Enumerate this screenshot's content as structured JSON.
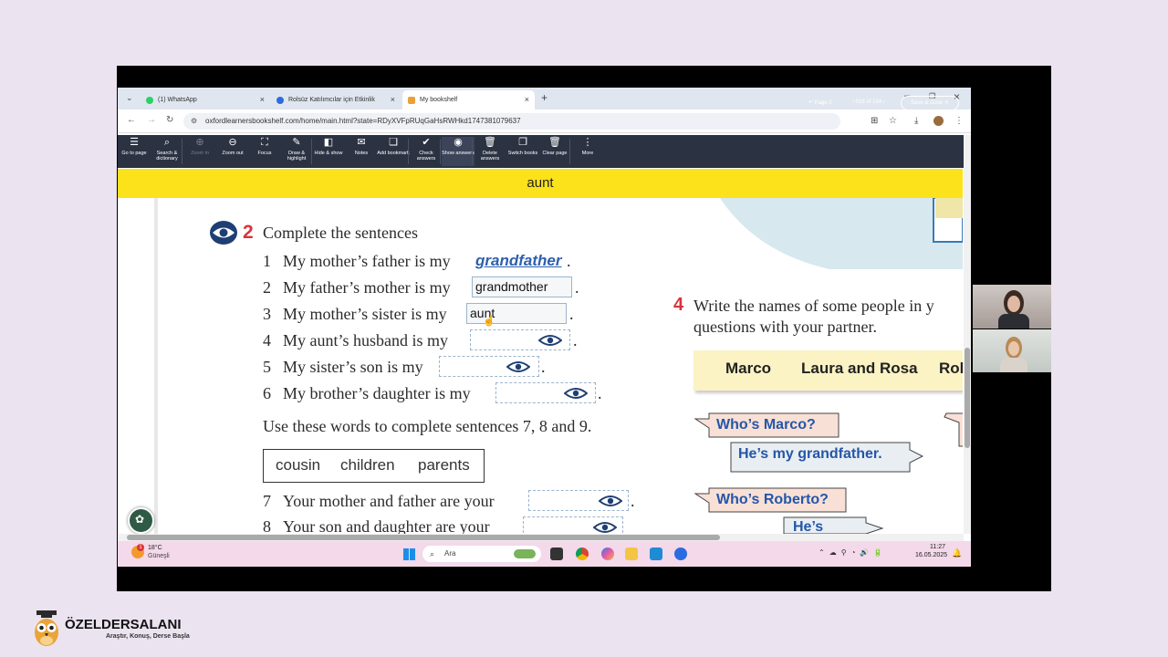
{
  "browser": {
    "tabs": [
      {
        "label": "(1) WhatsApp"
      },
      {
        "label": "Rolsüz Katılımcılar için Etkinlik"
      },
      {
        "label": "My bookshelf"
      }
    ],
    "url": "oxfordlearnersbookshelf.com/home/main.html?state=RDyXVFpRUqGaHsRWHkd1747381079637"
  },
  "toolbar": {
    "items": [
      {
        "icon": "list-icon",
        "label": "Go to page"
      },
      {
        "icon": "search-icon",
        "label": "Search & dictionary"
      },
      {
        "icon": "zoom-in-icon",
        "label": "Zoom in"
      },
      {
        "icon": "zoom-out-icon",
        "label": "Zoom out"
      },
      {
        "icon": "focus-icon",
        "label": "Focus"
      },
      {
        "icon": "pen-icon",
        "label": "Draw & highlight"
      },
      {
        "icon": "hide-icon",
        "label": "Hide & show"
      },
      {
        "icon": "notes-icon",
        "label": "Notes"
      },
      {
        "icon": "bookmark-icon",
        "label": "Add bookmark"
      },
      {
        "icon": "check-icon",
        "label": "Check answers"
      },
      {
        "icon": "eye-icon",
        "label": "Show answers"
      },
      {
        "icon": "trash-icon",
        "label": "Delete answers"
      },
      {
        "icon": "books-icon",
        "label": "Switch books"
      },
      {
        "icon": "trash-icon",
        "label": "Clear page"
      },
      {
        "icon": "more-icon",
        "label": "More"
      }
    ],
    "page_label": "Page 0",
    "page_count": "016 of 194",
    "save_close": "Save & close"
  },
  "banner": {
    "word": "aunt"
  },
  "exercise2": {
    "number": "2",
    "title": "Complete the sentences",
    "sentences": [
      {
        "n": "1",
        "text": "My mother’s father is my",
        "answer": "grandfather"
      },
      {
        "n": "2",
        "text": "My father’s mother is my",
        "answer": "grandmother"
      },
      {
        "n": "3",
        "text": "My mother’s sister is my",
        "answer": "aunt"
      },
      {
        "n": "4",
        "text": "My aunt’s husband is my",
        "answer": ""
      },
      {
        "n": "5",
        "text": "My sister’s son is my",
        "answer": ""
      },
      {
        "n": "6",
        "text": "My brother’s daughter is my",
        "answer": ""
      },
      {
        "n": "7",
        "text": "Your mother and father are your",
        "answer": ""
      },
      {
        "n": "8",
        "text": "Your son and daughter are your",
        "answer": ""
      }
    ],
    "instruction": "Use these words to complete sentences 7, 8 and 9.",
    "word_box": [
      "cousin",
      "children",
      "parents"
    ]
  },
  "exercise4": {
    "number": "4",
    "line1": "Write the names of some people in y",
    "line2": "questions with your partner.",
    "names": [
      "Marco",
      "Laura and Rosa",
      "Rob"
    ],
    "bubbles": [
      "Who’s Marco?",
      "He’s my grandfather.",
      "Who’s Roberto?",
      "He’s"
    ]
  },
  "taskbar": {
    "temp": "18°C",
    "weather": "Güneşli",
    "search": "Ara",
    "time": "11:27",
    "date": "16.05.2025",
    "weather_badge": "1"
  },
  "brand": {
    "name": "ÖZELDERSALANI",
    "slogan": "Araştır, Konuş, Derse Başla"
  }
}
